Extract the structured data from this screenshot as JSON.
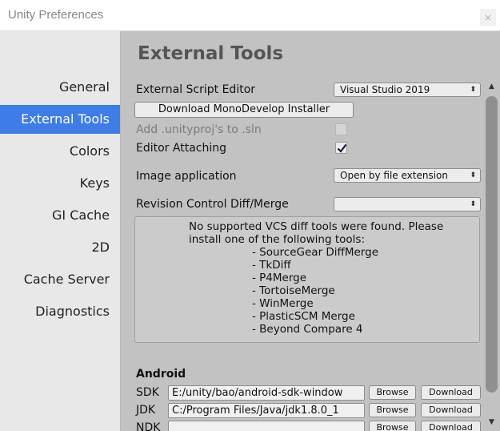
{
  "window": {
    "title": "Unity Preferences",
    "close": "×"
  },
  "sidebar": {
    "items": [
      {
        "label": "General"
      },
      {
        "label": "External Tools",
        "active": true
      },
      {
        "label": "Colors"
      },
      {
        "label": "Keys"
      },
      {
        "label": "GI Cache"
      },
      {
        "label": "2D"
      },
      {
        "label": "Cache Server"
      },
      {
        "label": "Diagnostics"
      }
    ]
  },
  "main": {
    "title": "External Tools",
    "script_editor": {
      "label": "External Script Editor",
      "value": "Visual Studio 2019"
    },
    "download_mono": "Download MonoDevelop Installer",
    "add_unityproj": {
      "label": "Add .unityproj's to .sln",
      "checked": false,
      "disabled": true
    },
    "editor_attaching": {
      "label": "Editor Attaching",
      "checked": true
    },
    "image_app": {
      "label": "Image application",
      "value": "Open by file extension"
    },
    "revision_control": {
      "label": "Revision Control Diff/Merge",
      "value": ""
    },
    "vcs_info": {
      "line1": "No supported VCS diff tools were found. Please",
      "line2": "install one of the following tools:",
      "tools": [
        "- SourceGear DiffMerge",
        "- TkDiff",
        "- P4Merge",
        "- TortoiseMerge",
        "- WinMerge",
        "- PlasticSCM Merge",
        "- Beyond Compare 4"
      ]
    },
    "android": {
      "heading": "Android",
      "rows": [
        {
          "label": "SDK",
          "path": "E:/unity/bao/android-sdk-window",
          "browse": "Browse",
          "download": "Download"
        },
        {
          "label": "JDK",
          "path": "C:/Program Files/Java/jdk1.8.0_1",
          "browse": "Browse",
          "download": "Download"
        },
        {
          "label": "NDK",
          "path": "",
          "browse": "Browse",
          "download": "Download"
        }
      ]
    }
  },
  "colors": {
    "active_item": "#3e7de7",
    "panel_bg": "#c2c2c2",
    "sidebar_bg": "#e8e8e8"
  }
}
